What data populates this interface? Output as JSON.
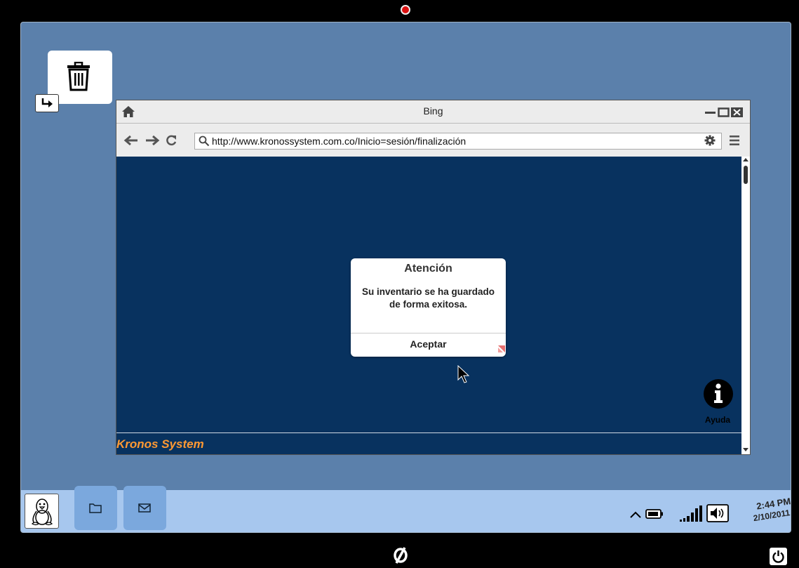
{
  "browser": {
    "title": "Bing",
    "url": "http://www.kronossystem.com.co/Inicio=sesión/finalización"
  },
  "dialog": {
    "title": "Atención",
    "message": "Su inventario se ha guardado de forma exitosa.",
    "button_label": "Aceptar"
  },
  "help": {
    "label": "Ayuda"
  },
  "footer": {
    "brand": "Kronos System"
  },
  "taskbar": {
    "time": "2:44 PM",
    "date": "2/10/2011"
  },
  "colors": {
    "screen_bg": "#5b80ab",
    "content_bg": "#08325f",
    "taskbar_bg": "#a7c7ee",
    "brand_accent": "#ff9933",
    "camera": "#dd1111"
  },
  "icons": {
    "desktop": [
      "trash-icon",
      "shortcut-arrow-icon"
    ],
    "browser": [
      "home-icon",
      "minimize-icon",
      "maximize-icon",
      "close-icon",
      "back-arrow-icon",
      "forward-arrow-icon",
      "reload-icon",
      "search-icon",
      "gear-icon",
      "hamburger-menu-icon"
    ],
    "content": [
      "info-icon",
      "mouse-cursor-icon"
    ],
    "taskbar": [
      "linux-penguin-icon",
      "folder-icon",
      "mail-icon",
      "chevron-up-icon",
      "battery-icon",
      "signal-icon",
      "speaker-icon"
    ],
    "device": [
      "power-icon",
      "home-logo-icon"
    ]
  }
}
